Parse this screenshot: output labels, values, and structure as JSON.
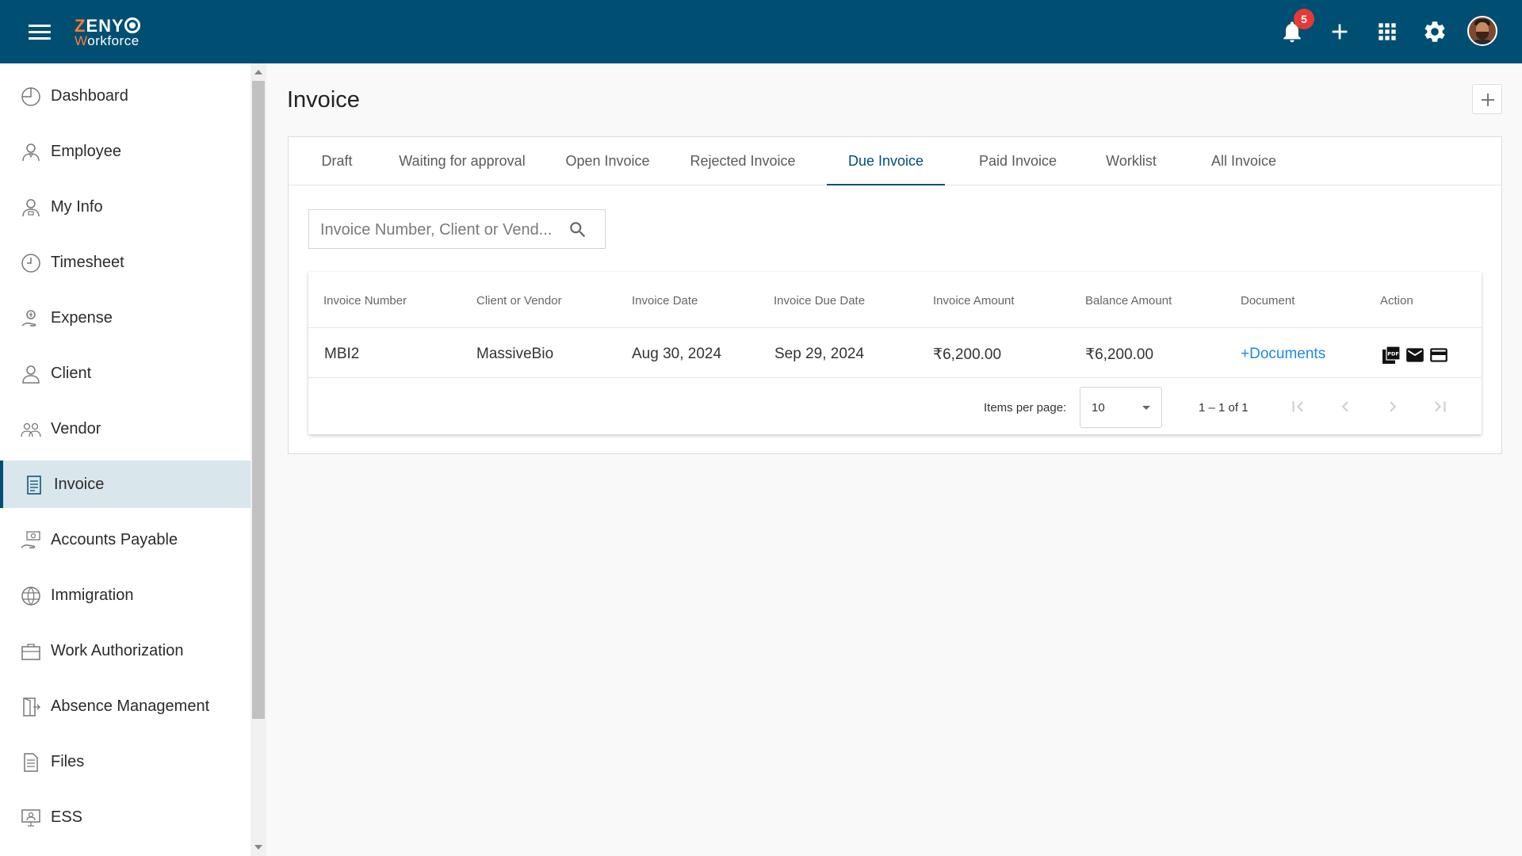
{
  "brand": {
    "line1": "ZENYO",
    "line2": "Workforce"
  },
  "header": {
    "notification_count": "5",
    "icons": [
      "menu-icon",
      "bell-icon",
      "plus-icon",
      "apps-grid-icon",
      "gear-icon",
      "avatar"
    ]
  },
  "sidebar": {
    "items": [
      {
        "label": "Dashboard",
        "icon": "dashboard-icon"
      },
      {
        "label": "Employee",
        "icon": "employee-icon"
      },
      {
        "label": "My Info",
        "icon": "my-info-icon"
      },
      {
        "label": "Timesheet",
        "icon": "clock-icon"
      },
      {
        "label": "Expense",
        "icon": "expense-icon"
      },
      {
        "label": "Client",
        "icon": "client-icon"
      },
      {
        "label": "Vendor",
        "icon": "vendor-icon"
      },
      {
        "label": "Invoice",
        "icon": "invoice-icon",
        "active": true
      },
      {
        "label": "Accounts Payable",
        "icon": "accounts-payable-icon"
      },
      {
        "label": "Immigration",
        "icon": "globe-icon"
      },
      {
        "label": "Work Authorization",
        "icon": "briefcase-icon"
      },
      {
        "label": "Absence Management",
        "icon": "door-exit-icon"
      },
      {
        "label": "Files",
        "icon": "file-icon"
      },
      {
        "label": "ESS",
        "icon": "ess-icon"
      }
    ]
  },
  "page": {
    "title": "Invoice"
  },
  "tabs": [
    {
      "label": "Draft"
    },
    {
      "label": "Waiting for approval"
    },
    {
      "label": "Open Invoice"
    },
    {
      "label": "Rejected Invoice"
    },
    {
      "label": "Due Invoice",
      "active": true
    },
    {
      "label": "Paid Invoice"
    },
    {
      "label": "Worklist"
    },
    {
      "label": "All Invoice"
    }
  ],
  "search": {
    "placeholder": "Invoice Number, Client or Vend...",
    "value": ""
  },
  "table": {
    "columns": [
      "Invoice Number",
      "Client or Vendor",
      "Invoice Date",
      "Invoice Due Date",
      "Invoice Amount",
      "Balance Amount",
      "Document",
      "Action"
    ],
    "rows": [
      {
        "invoice_number": "MBI2",
        "client_or_vendor": "MassiveBio",
        "invoice_date": "Aug 30, 2024",
        "due_date": "Sep 29, 2024",
        "invoice_amount": "₹6,200.00",
        "balance_amount": "₹6,200.00",
        "document": "+Documents",
        "actions": [
          "pdf-icon",
          "email-icon",
          "payment-card-icon"
        ]
      }
    ]
  },
  "pagination": {
    "items_per_page_label": "Items per page:",
    "items_per_page": "10",
    "range": "1 – 1 of 1"
  },
  "colors": {
    "topbar": "#004f73",
    "accent": "#004f73",
    "active_nav_bg": "#d9e6ec",
    "badge": "#e53935",
    "link": "#1e88e5",
    "brand_orange": "#ff7a33"
  }
}
